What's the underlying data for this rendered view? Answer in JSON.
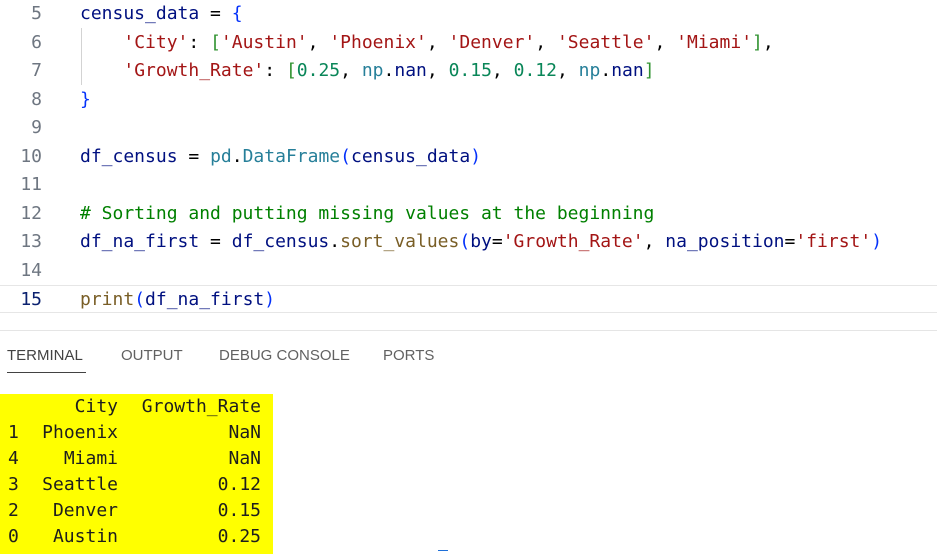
{
  "editor": {
    "lines": [
      {
        "num": "5",
        "tokens": [
          {
            "t": "census_data",
            "c": "t-plain"
          },
          {
            "t": " = ",
            "c": "t-text"
          },
          {
            "t": "{",
            "c": "t-br1"
          }
        ]
      },
      {
        "num": "6",
        "tokens": [
          {
            "t": "    ",
            "c": "t-text"
          },
          {
            "t": "'City'",
            "c": "t-str"
          },
          {
            "t": ": ",
            "c": "t-text"
          },
          {
            "t": "[",
            "c": "t-br2"
          },
          {
            "t": "'Austin'",
            "c": "t-str"
          },
          {
            "t": ", ",
            "c": "t-text"
          },
          {
            "t": "'Phoenix'",
            "c": "t-str"
          },
          {
            "t": ", ",
            "c": "t-text"
          },
          {
            "t": "'Denver'",
            "c": "t-str"
          },
          {
            "t": ", ",
            "c": "t-text"
          },
          {
            "t": "'Seattle'",
            "c": "t-str"
          },
          {
            "t": ", ",
            "c": "t-text"
          },
          {
            "t": "'Miami'",
            "c": "t-str"
          },
          {
            "t": "]",
            "c": "t-br2"
          },
          {
            "t": ",",
            "c": "t-text"
          }
        ]
      },
      {
        "num": "7",
        "tokens": [
          {
            "t": "    ",
            "c": "t-text"
          },
          {
            "t": "'Growth_Rate'",
            "c": "t-str"
          },
          {
            "t": ": ",
            "c": "t-text"
          },
          {
            "t": "[",
            "c": "t-br2"
          },
          {
            "t": "0.25",
            "c": "t-num"
          },
          {
            "t": ", ",
            "c": "t-text"
          },
          {
            "t": "np",
            "c": "t-mod"
          },
          {
            "t": ".",
            "c": "t-text"
          },
          {
            "t": "nan",
            "c": "t-attr"
          },
          {
            "t": ", ",
            "c": "t-text"
          },
          {
            "t": "0.15",
            "c": "t-num"
          },
          {
            "t": ", ",
            "c": "t-text"
          },
          {
            "t": "0.12",
            "c": "t-num"
          },
          {
            "t": ", ",
            "c": "t-text"
          },
          {
            "t": "np",
            "c": "t-mod"
          },
          {
            "t": ".",
            "c": "t-text"
          },
          {
            "t": "nan",
            "c": "t-attr"
          },
          {
            "t": "]",
            "c": "t-br2"
          }
        ]
      },
      {
        "num": "8",
        "tokens": [
          {
            "t": "}",
            "c": "t-br1"
          }
        ]
      },
      {
        "num": "9",
        "tokens": []
      },
      {
        "num": "10",
        "tokens": [
          {
            "t": "df_census",
            "c": "t-plain"
          },
          {
            "t": " = ",
            "c": "t-text"
          },
          {
            "t": "pd",
            "c": "t-mod"
          },
          {
            "t": ".",
            "c": "t-text"
          },
          {
            "t": "DataFrame",
            "c": "t-mod"
          },
          {
            "t": "(",
            "c": "t-br1"
          },
          {
            "t": "census_data",
            "c": "t-plain"
          },
          {
            "t": ")",
            "c": "t-br1"
          }
        ]
      },
      {
        "num": "11",
        "tokens": []
      },
      {
        "num": "12",
        "tokens": [
          {
            "t": "# Sorting and putting missing values at the beginning",
            "c": "t-com"
          }
        ]
      },
      {
        "num": "13",
        "tokens": [
          {
            "t": "df_na_first",
            "c": "t-plain"
          },
          {
            "t": " = ",
            "c": "t-text"
          },
          {
            "t": "df_census",
            "c": "t-plain"
          },
          {
            "t": ".",
            "c": "t-text"
          },
          {
            "t": "sort_values",
            "c": "t-fn"
          },
          {
            "t": "(",
            "c": "t-br1"
          },
          {
            "t": "by",
            "c": "t-plain"
          },
          {
            "t": "=",
            "c": "t-text"
          },
          {
            "t": "'Growth_Rate'",
            "c": "t-str"
          },
          {
            "t": ", ",
            "c": "t-text"
          },
          {
            "t": "na_position",
            "c": "t-plain"
          },
          {
            "t": "=",
            "c": "t-text"
          },
          {
            "t": "'first'",
            "c": "t-str"
          },
          {
            "t": ")",
            "c": "t-br1"
          }
        ]
      },
      {
        "num": "14",
        "tokens": []
      },
      {
        "num": "15",
        "current": true,
        "tokens": [
          {
            "t": "print",
            "c": "t-fn"
          },
          {
            "t": "(",
            "c": "t-br1"
          },
          {
            "t": "df_na_first",
            "c": "t-plain"
          },
          {
            "t": ")",
            "c": "t-br1"
          }
        ]
      }
    ]
  },
  "panel": {
    "tabs": [
      {
        "label": "TERMINAL",
        "active": true
      },
      {
        "label": "OUTPUT",
        "active": false
      },
      {
        "label": "DEBUG CONSOLE",
        "active": false
      },
      {
        "label": "PORTS",
        "active": false
      }
    ]
  },
  "terminal": {
    "highlight_color": "#ffff00",
    "header": {
      "index": "",
      "city": "City",
      "rate": "Growth_Rate"
    },
    "rows": [
      {
        "index": "1",
        "city": "Phoenix",
        "rate": "NaN"
      },
      {
        "index": "4",
        "city": "Miami",
        "rate": "NaN"
      },
      {
        "index": "3",
        "city": "Seattle",
        "rate": "0.12"
      },
      {
        "index": "2",
        "city": "Denver",
        "rate": "0.15"
      },
      {
        "index": "0",
        "city": "Austin",
        "rate": "0.25"
      }
    ]
  }
}
